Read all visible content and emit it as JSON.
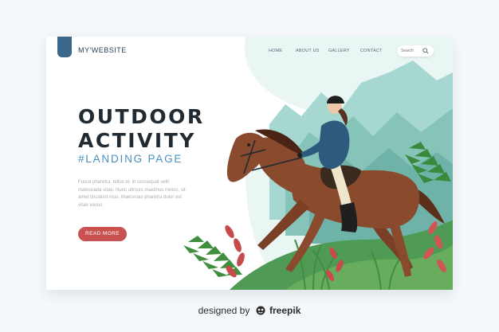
{
  "header": {
    "logo": "MY'WEBSITE"
  },
  "nav": [
    {
      "label": "HOME"
    },
    {
      "label": "ABOUT US"
    },
    {
      "label": "GALLERY"
    },
    {
      "label": "CONTACT"
    }
  ],
  "search": {
    "placeholder": "Search"
  },
  "hero": {
    "title_line1": "OUTDOOR",
    "title_line2": "ACTIVITY",
    "subtitle": "#LANDING PAGE",
    "body": "Fusce pharetra, tellus et, in consequat velit malesuada vitae. Nunc ultrices maximus metus, sit amet tincidunt mus. Maecenas pharetra dolor est vitae varius.",
    "button": "READ MORE"
  },
  "footer": {
    "prefix": "designed by",
    "brand": "freepik"
  },
  "colors": {
    "accent": "#c9514f",
    "subtitle": "#4a8fbf",
    "mountain": "#7fbfb8",
    "horse": "#8a4a2e",
    "jacket": "#2d5a7d"
  }
}
